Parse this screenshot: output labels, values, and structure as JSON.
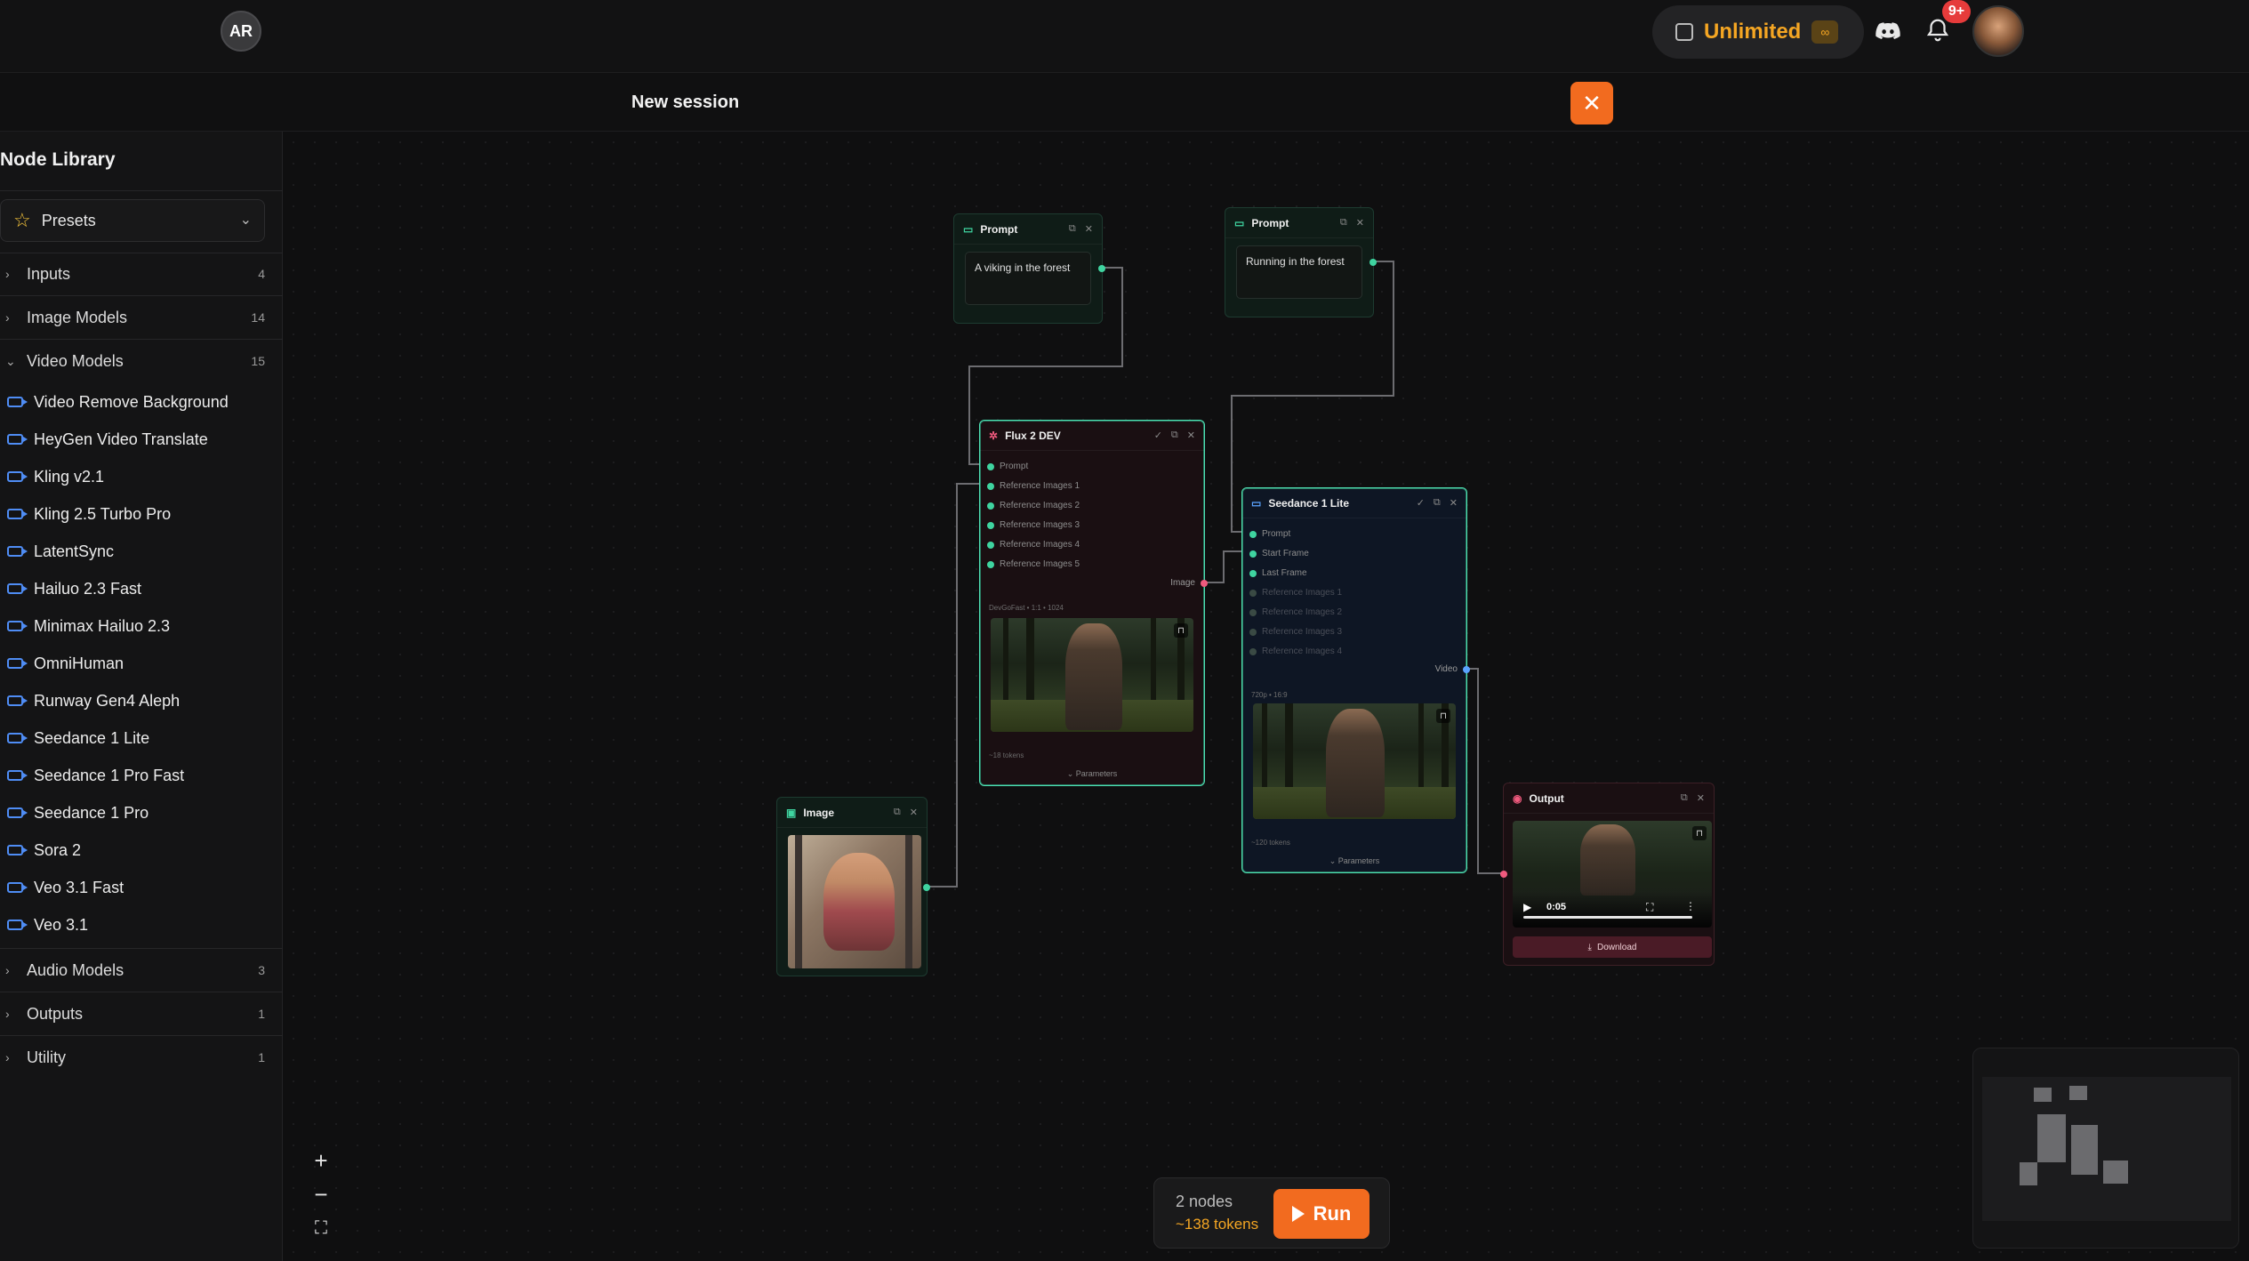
{
  "topbar": {
    "logo_text": "AR",
    "plan_label": "Unlimited",
    "plan_badge": "∞",
    "notifications_count": "9+",
    "icons": [
      "wallet-icon",
      "discord-icon",
      "bell-icon"
    ]
  },
  "session": {
    "title": "New session",
    "close_glyph": "✕"
  },
  "sidebar": {
    "title": "Node Library",
    "presets_label": "Presets",
    "categories": [
      {
        "label": "Inputs",
        "count": "4"
      },
      {
        "label": "Image Models",
        "count": "14"
      },
      {
        "label": "Video Models",
        "count": "15"
      },
      {
        "label": "Audio Models",
        "count": "3"
      },
      {
        "label": "Outputs",
        "count": "1"
      },
      {
        "label": "Utility",
        "count": "1"
      }
    ],
    "video_models": [
      "Video Remove Background",
      "HeyGen Video Translate",
      "Kling v2.1",
      "Kling 2.5 Turbo Pro",
      "LatentSync",
      "Hailuo 2.3 Fast",
      "Minimax Hailuo 2.3",
      "OmniHuman",
      "Runway Gen4 Aleph",
      "Seedance 1 Lite",
      "Seedance 1 Pro Fast",
      "Seedance 1 Pro",
      "Sora 2",
      "Veo 3.1 Fast",
      "Veo 3.1"
    ]
  },
  "nodes": {
    "prompt1": {
      "title": "Prompt",
      "text": "A viking in the forest"
    },
    "prompt2": {
      "title": "Prompt",
      "text": "Running in the forest"
    },
    "flux": {
      "title": "Flux 2 DEV",
      "inputs": [
        "Prompt",
        "Reference Images 1",
        "Reference Images 2",
        "Reference Images 3",
        "Reference Images 4",
        "Reference Images 5"
      ],
      "output_label": "Image",
      "meta": "DevGoFast • 1:1 • 1024",
      "tokens": "~18 tokens",
      "params": "Parameters"
    },
    "seedance": {
      "title": "Seedance 1 Lite",
      "inputs": [
        "Prompt",
        "Start Frame",
        "Last Frame"
      ],
      "inputs_dim": [
        "Reference Images 1",
        "Reference Images 2",
        "Reference Images 3",
        "Reference Images 4"
      ],
      "output_label": "Video",
      "meta": "720p • 16:9",
      "tokens": "~120 tokens",
      "params": "Parameters"
    },
    "image": {
      "title": "Image"
    },
    "output": {
      "title": "Output",
      "time": "0:05",
      "download": "Download"
    }
  },
  "run": {
    "nodes_text": "2 nodes",
    "tokens_text": "~138 tokens",
    "button": "Run"
  },
  "zoom": {
    "in": "+",
    "out": "−",
    "fit": "⛶"
  },
  "colors": {
    "accent_orange": "#f26b1f",
    "plan_gold": "#f5a623",
    "port_green": "#3fd4a0",
    "port_pink": "#f05a7e",
    "port_blue": "#5aa3ff",
    "node_border_active": "#4fe0b3"
  }
}
